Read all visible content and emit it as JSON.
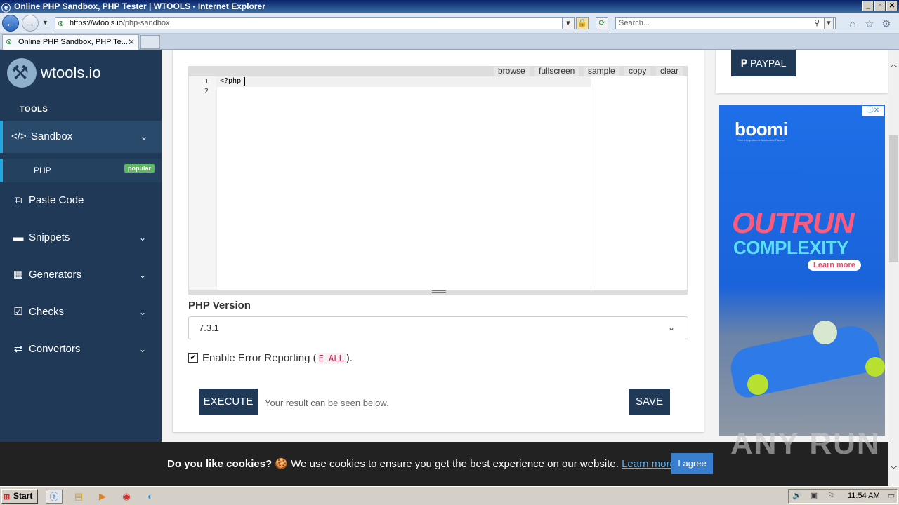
{
  "browser": {
    "title": "Online PHP Sandbox, PHP Tester | WTOOLS - Internet Explorer",
    "url_prefix": "https://",
    "url_domain": "wtools.io",
    "url_path": "/php-sandbox",
    "search_placeholder": "Search...",
    "tab_label": "Online PHP Sandbox, PHP Te...",
    "tab_close": "✕"
  },
  "sidebar": {
    "logo_text": "wtools.io",
    "section_label": "TOOLS",
    "items": [
      {
        "label": "Sandbox",
        "icon": "</>"
      },
      {
        "label": "Paste Code",
        "icon": "⧉"
      },
      {
        "label": "Snippets",
        "icon": "▬"
      },
      {
        "label": "Generators",
        "icon": "▦"
      },
      {
        "label": "Checks",
        "icon": "☑"
      },
      {
        "label": "Convertors",
        "icon": "⇄"
      }
    ],
    "sub_item": {
      "label": "PHP",
      "badge": "popular"
    }
  },
  "editor": {
    "toolbar": [
      "browse",
      "fullscreen",
      "sample",
      "copy",
      "clear"
    ],
    "line_numbers": [
      "1",
      "2"
    ],
    "code": "<?php"
  },
  "form": {
    "version_label": "PHP Version",
    "version_value": "7.3.1",
    "error_label_prefix": "Enable Error Reporting (",
    "error_code": "E_ALL",
    "error_label_suffix": ").",
    "error_checked": true,
    "execute_label": "EXECUTE",
    "result_text": "Your result can be seen below.",
    "save_label": "SAVE"
  },
  "right": {
    "paypal_label": "PAYPAL",
    "ad": {
      "brand": "boomi",
      "brand_sub": "Your Integration & Automation Partner",
      "headline1": "OUTRUN",
      "headline2": "COMPLEXITY",
      "cta": "Learn more"
    }
  },
  "cookie": {
    "bold": "Do you like cookies?",
    "text": " 🍪 We use cookies to ensure you get the best experience on our website. ",
    "link": "Learn more",
    "button": "I agree"
  },
  "watermark": "ANY RUN",
  "taskbar": {
    "start_label": "Start",
    "clock": "11:54 AM"
  },
  "colors": {
    "sidebar_bg": "#1f3956",
    "accent": "#22a7e0",
    "badge": "#5cb85c",
    "button": "#1f3956",
    "cookie_button": "#3a7ed0"
  }
}
